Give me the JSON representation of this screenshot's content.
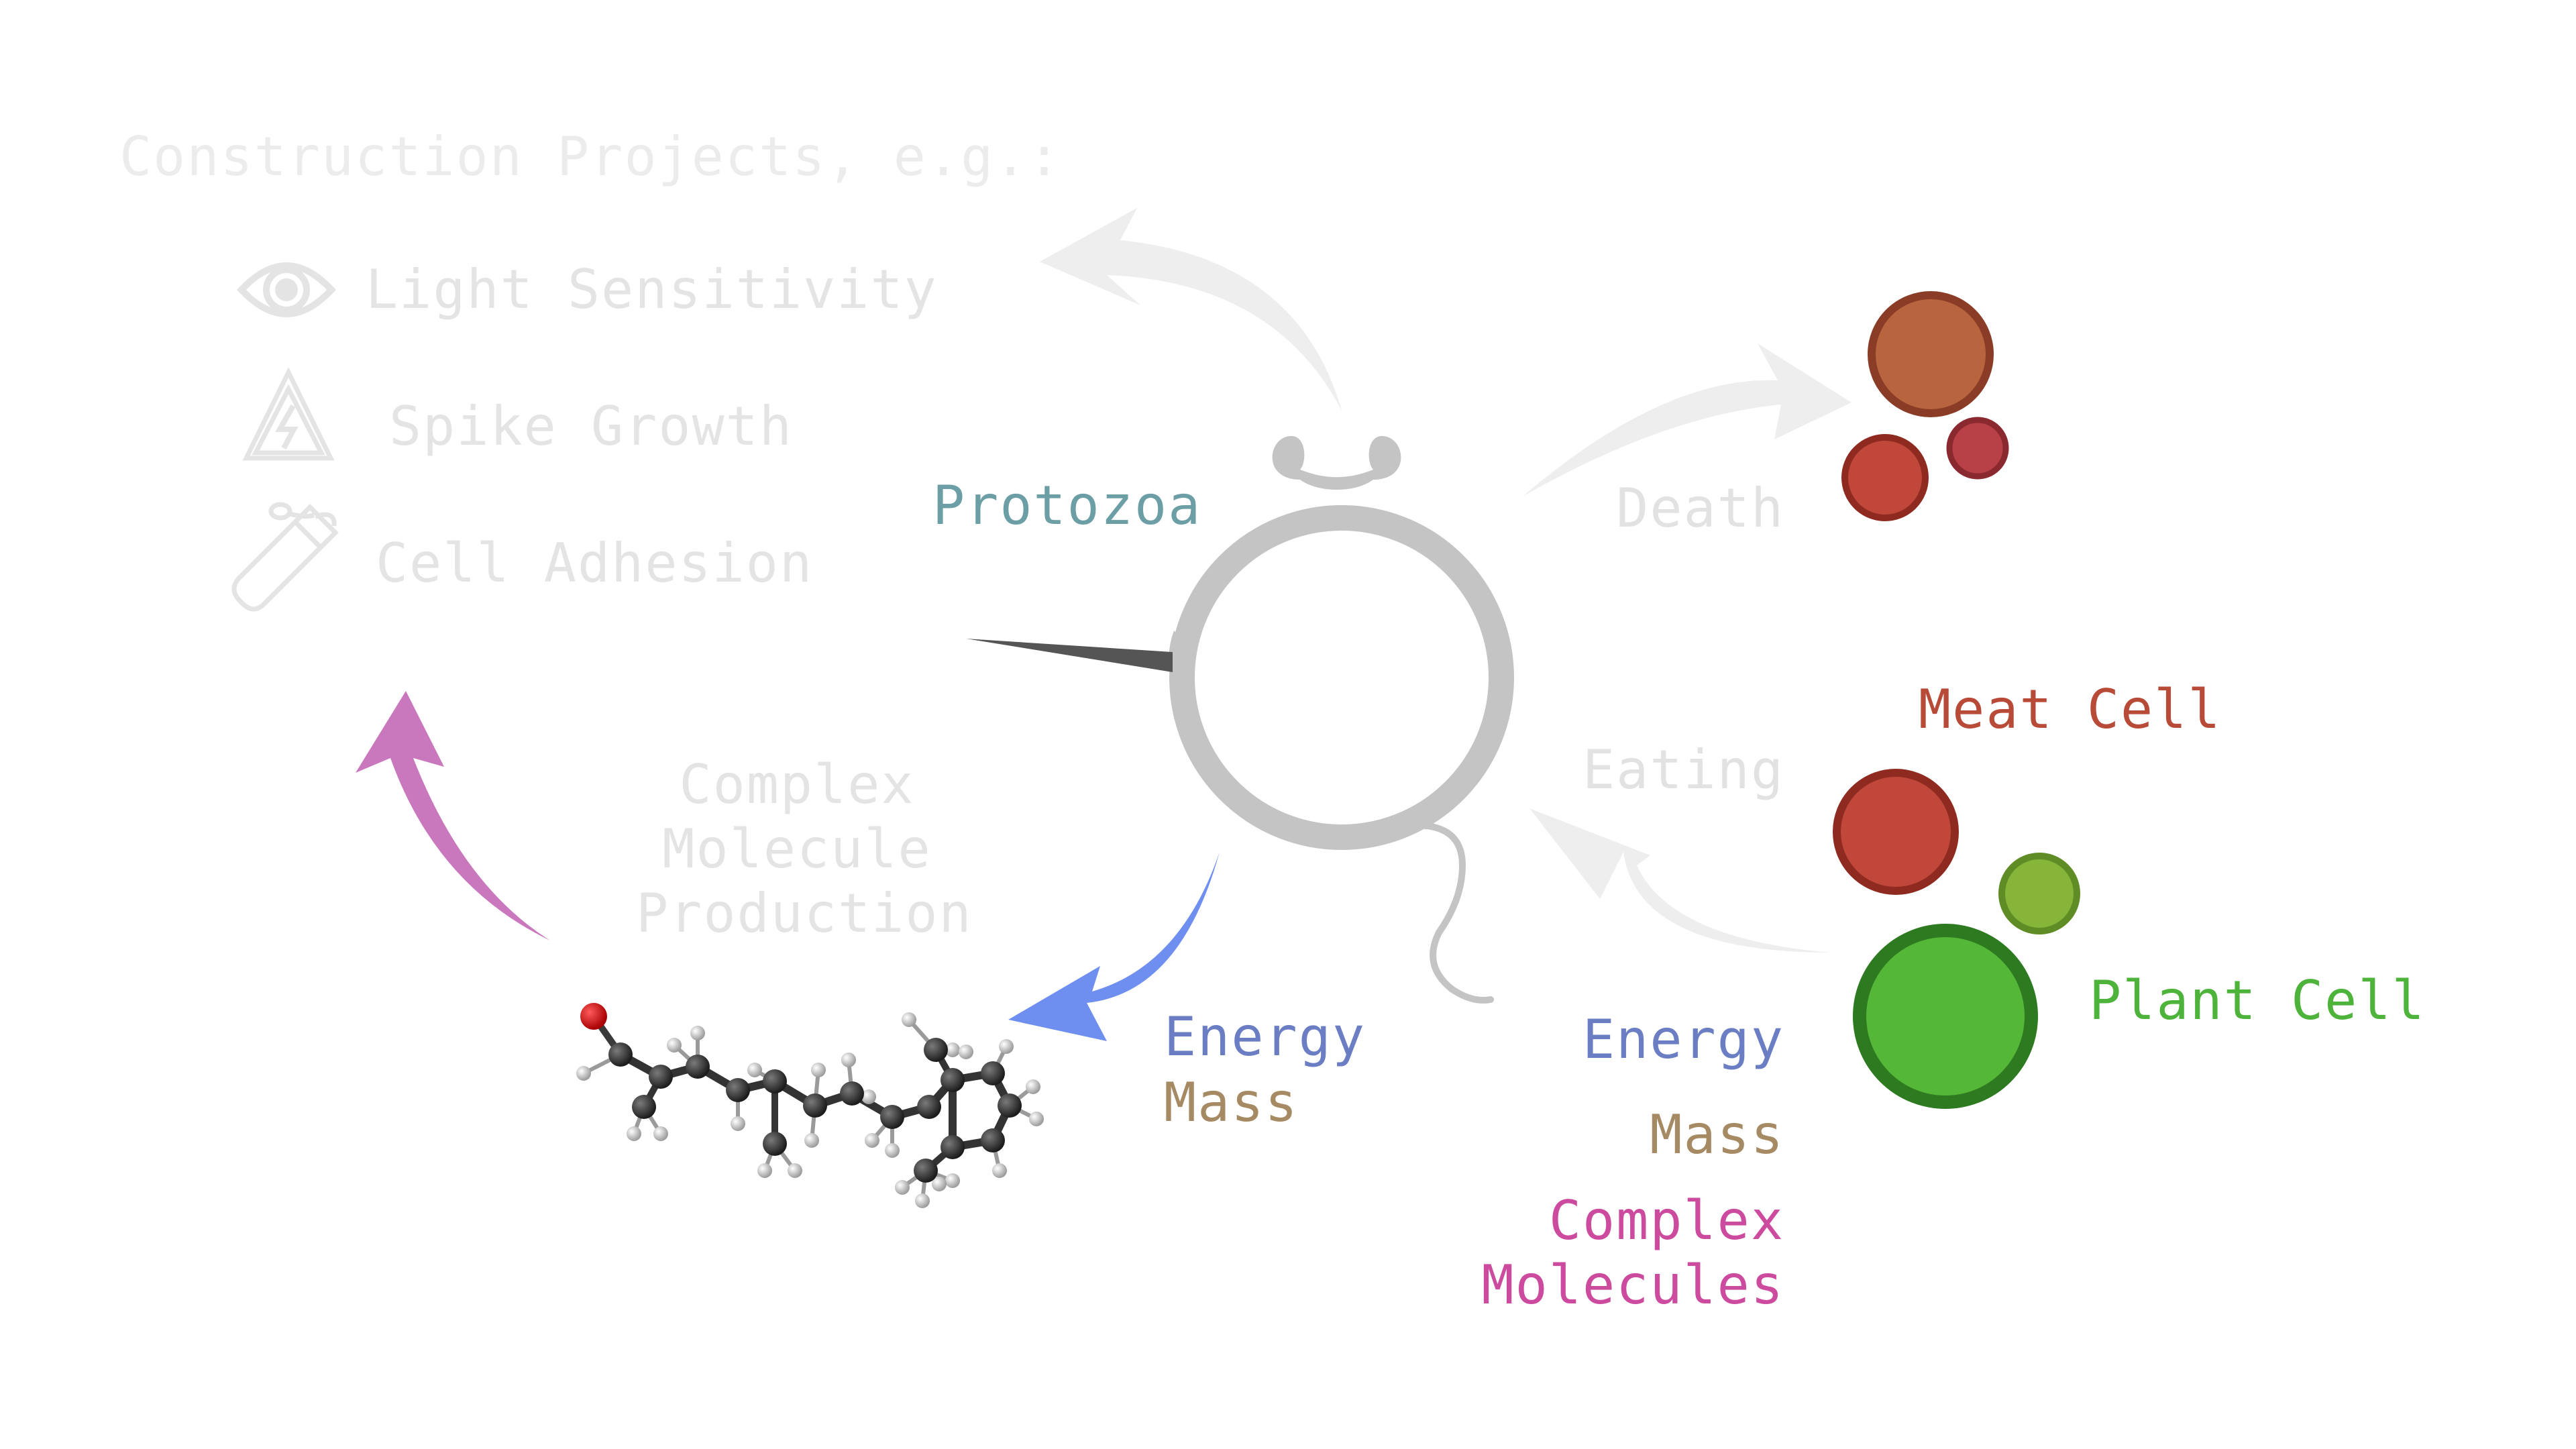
{
  "construction": {
    "title": "Construction Projects, e.g.:",
    "items": [
      {
        "label": "Light Sensitivity",
        "icon": "eye-icon"
      },
      {
        "label": "Spike Growth",
        "icon": "warning-triangle-icon"
      },
      {
        "label": "Cell Adhesion",
        "icon": "glue-tube-icon"
      }
    ]
  },
  "protozoa": {
    "label": "Protozoa"
  },
  "death": {
    "label": "Death"
  },
  "eating": {
    "label": "Eating"
  },
  "meat_cell": {
    "label": "Meat Cell"
  },
  "plant_cell": {
    "label": "Plant Cell"
  },
  "production": {
    "line1": "Complex",
    "line2": "Molecule",
    "line3": "Production"
  },
  "output": {
    "energy": "Energy",
    "mass": "Mass"
  },
  "input": {
    "energy": "Energy",
    "mass": "Mass",
    "complex1": "Complex",
    "complex2": "Molecules"
  },
  "colors": {
    "faded": "#e4e4e4",
    "protozoa": "#6c9ea6",
    "meat": "#b84a38",
    "plant": "#4db33a",
    "energy": "#6b7ec4",
    "mass": "#a58a63",
    "complex": "#cc4b9f",
    "arrow_pink": "#c978bd",
    "arrow_blue": "#6f8ff0",
    "membrane": "#c4c4c4"
  }
}
